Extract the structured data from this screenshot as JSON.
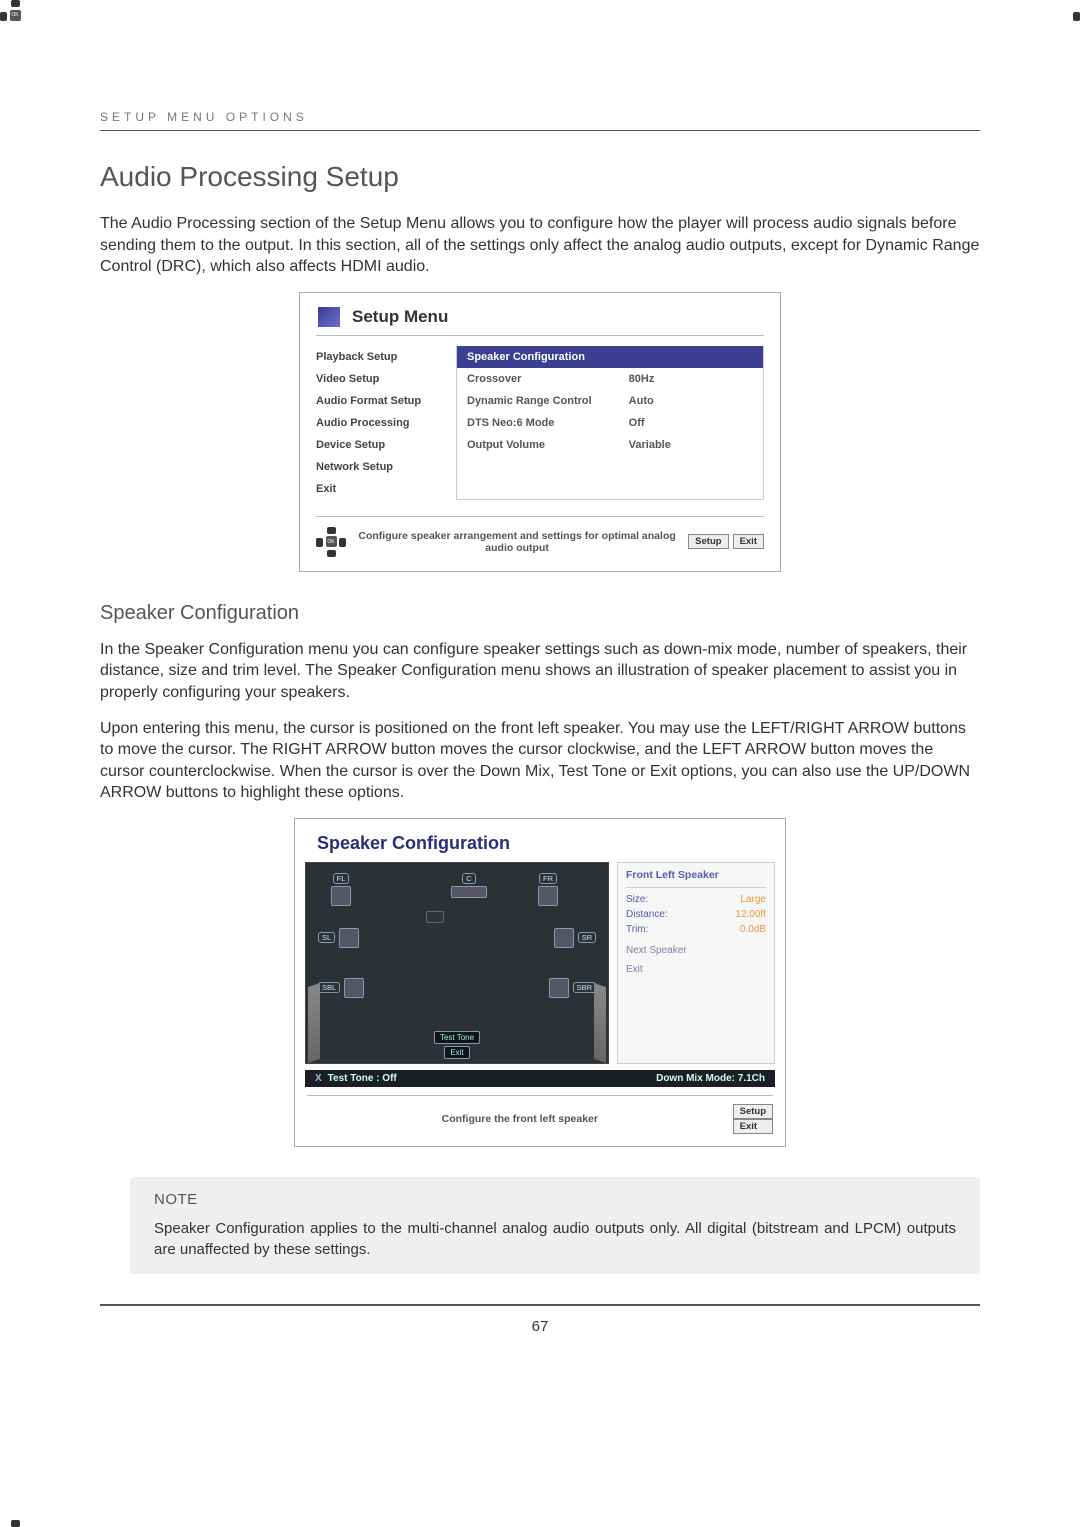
{
  "header_text": "SETUP MENU OPTIONS",
  "h1": "Audio Processing Setup",
  "intro": "The Audio Processing section of the Setup Menu allows you to configure how the player will process audio signals before sending them to the output. In this section, all of the settings only affect the analog audio outputs, except for Dynamic Range Control (DRC), which also affects HDMI audio.",
  "setup_menu": {
    "title": "Setup Menu",
    "left": [
      "Playback Setup",
      "Video Setup",
      "Audio Format Setup",
      "Audio Processing",
      "Device Setup",
      "Network Setup",
      "Exit"
    ],
    "header_row": "Speaker Configuration",
    "rows": [
      {
        "k": "Crossover",
        "v": "80Hz"
      },
      {
        "k": "Dynamic Range Control",
        "v": "Auto"
      },
      {
        "k": "DTS Neo:6 Mode",
        "v": "Off"
      },
      {
        "k": "Output Volume",
        "v": "Variable"
      }
    ],
    "hint": "Configure speaker arrangement and settings for optimal analog audio output",
    "btn_setup": "Setup",
    "btn_exit": "Exit",
    "ok": "OK"
  },
  "h2": "Speaker Configuration",
  "p1": "In the Speaker Configuration menu you can configure speaker settings such as down-mix mode, number of speakers, their distance, size and trim level. The Speaker Configuration menu shows an illustration of speaker placement to assist you in properly configuring your speakers.",
  "p2": "Upon entering this menu, the cursor is positioned on the front left speaker. You may use the LEFT/RIGHT ARROW buttons to move the cursor. The RIGHT ARROW button moves the cursor clockwise, and the LEFT ARROW button moves the cursor counterclockwise. When the cursor is over the Down Mix, Test Tone or Exit options, you can also use the UP/DOWN ARROW buttons to highlight these options.",
  "spk_menu": {
    "title": "Speaker Configuration",
    "labels": {
      "FL": "FL",
      "FR": "FR",
      "C": "C",
      "SL": "SL",
      "SR": "SR",
      "SBL": "SBL",
      "SBR": "SBR"
    },
    "person_btns": [
      "Test Tone",
      "Exit"
    ],
    "side_title": "Front Left Speaker",
    "side_rows": [
      {
        "k": "Size:",
        "v": "Large"
      },
      {
        "k": "Distance:",
        "v": "12.00ft"
      },
      {
        "k": "Trim:",
        "v": "0.0dB"
      }
    ],
    "side_nav": [
      "Next Speaker",
      "Exit"
    ],
    "bar_left_icon": "X",
    "bar_left": "Test Tone : Off",
    "bar_right": "Down Mix Mode: 7.1Ch",
    "hint": "Configure the front left speaker",
    "btn_setup": "Setup",
    "btn_exit": "Exit",
    "ok": "OK"
  },
  "note": {
    "title": "NOTE",
    "text": "Speaker Configuration applies to the multi-channel analog audio outputs only. All digital (bitstream and LPCM) outputs are unaffected by these settings."
  },
  "page_number": "67"
}
